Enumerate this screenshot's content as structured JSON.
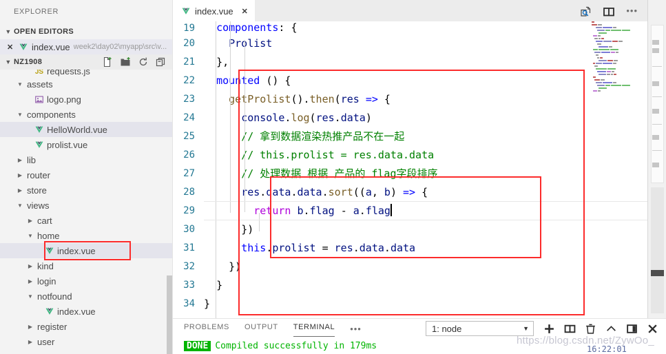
{
  "sidebar": {
    "title": "EXPLORER",
    "open_editors": {
      "header": "OPEN EDITORS",
      "rows": [
        {
          "close": "✕",
          "icon": "vue-icon",
          "name": "index.vue",
          "path": "week2\\day02\\myapp\\src\\v..."
        }
      ]
    },
    "project": {
      "header": "NZ1908",
      "actions": [
        {
          "name": "new-file-icon",
          "title": "New File"
        },
        {
          "name": "new-folder-icon",
          "title": "New Folder"
        },
        {
          "name": "refresh-icon",
          "title": "Refresh Explorer"
        },
        {
          "name": "collapse-all-icon",
          "title": "Collapse Folders"
        }
      ]
    },
    "tree": [
      {
        "label": "requests.js",
        "indent": 2,
        "kind": "js",
        "arrow": "none",
        "selected": false,
        "clipped": true
      },
      {
        "label": "assets",
        "indent": 1,
        "kind": "folder",
        "arrow": "open",
        "selected": false
      },
      {
        "label": "logo.png",
        "indent": 2,
        "kind": "png",
        "arrow": "none",
        "selected": false
      },
      {
        "label": "components",
        "indent": 1,
        "kind": "folder",
        "arrow": "open",
        "selected": false
      },
      {
        "label": "HelloWorld.vue",
        "indent": 2,
        "kind": "vue",
        "arrow": "none",
        "selected": true
      },
      {
        "label": "prolist.vue",
        "indent": 2,
        "kind": "vue",
        "arrow": "none",
        "selected": false
      },
      {
        "label": "lib",
        "indent": 1,
        "kind": "folder",
        "arrow": "closed",
        "selected": false
      },
      {
        "label": "router",
        "indent": 1,
        "kind": "folder",
        "arrow": "closed",
        "selected": false
      },
      {
        "label": "store",
        "indent": 1,
        "kind": "folder",
        "arrow": "closed",
        "selected": false
      },
      {
        "label": "views",
        "indent": 1,
        "kind": "folder",
        "arrow": "open",
        "selected": false
      },
      {
        "label": "cart",
        "indent": 2,
        "kind": "folder",
        "arrow": "closed",
        "selected": false
      },
      {
        "label": "home",
        "indent": 2,
        "kind": "folder",
        "arrow": "open",
        "selected": false
      },
      {
        "label": "index.vue",
        "indent": 3,
        "kind": "vue",
        "arrow": "none",
        "selected": true,
        "highlight": true
      },
      {
        "label": "kind",
        "indent": 2,
        "kind": "folder",
        "arrow": "closed",
        "selected": false
      },
      {
        "label": "login",
        "indent": 2,
        "kind": "folder",
        "arrow": "closed",
        "selected": false
      },
      {
        "label": "notfound",
        "indent": 2,
        "kind": "folder",
        "arrow": "open",
        "selected": false
      },
      {
        "label": "index.vue",
        "indent": 3,
        "kind": "vue",
        "arrow": "none",
        "selected": false
      },
      {
        "label": "register",
        "indent": 2,
        "kind": "folder",
        "arrow": "closed",
        "selected": false
      },
      {
        "label": "user",
        "indent": 2,
        "kind": "folder",
        "arrow": "closed",
        "selected": false
      }
    ]
  },
  "editor": {
    "tab": {
      "name": "index.vue",
      "close": "✕",
      "icon": "vue-icon"
    },
    "tab_actions": [
      {
        "name": "open-preview-icon"
      },
      {
        "name": "split-editor-icon"
      },
      {
        "name": "more-actions-icon",
        "label": "•••"
      }
    ],
    "first_line_number": 19,
    "lines": [
      {
        "n": 19,
        "text": "  components: {",
        "clipped": true
      },
      {
        "n": 20,
        "text": "    Prolist"
      },
      {
        "n": 21,
        "text": "  },"
      },
      {
        "n": 22,
        "text": "  mounted () {"
      },
      {
        "n": 23,
        "text": "    getProlist().then(res => {"
      },
      {
        "n": 24,
        "text": "      console.log(res.data)"
      },
      {
        "n": 25,
        "text": "      // 拿到数据渲染热推产品不在一起"
      },
      {
        "n": 26,
        "text": "      // this.prolist = res.data.data"
      },
      {
        "n": 27,
        "text": "      // 处理数据 根据 产品的 flag字段排序"
      },
      {
        "n": 28,
        "text": "      res.data.data.sort((a, b) => {"
      },
      {
        "n": 29,
        "text": "        return b.flag - a.flag",
        "cursor": true
      },
      {
        "n": 30,
        "text": "      })"
      },
      {
        "n": 31,
        "text": "      this.prolist = res.data.data"
      },
      {
        "n": 32,
        "text": "    })"
      },
      {
        "n": 33,
        "text": "  }"
      },
      {
        "n": 34,
        "text": "}"
      }
    ],
    "annotations": [
      {
        "name": "mounted-block-highlight"
      },
      {
        "name": "sort-block-highlight"
      },
      {
        "name": "sidebar-index-vue-highlight"
      }
    ]
  },
  "panel": {
    "tabs": [
      {
        "label": "PROBLEMS",
        "active": false
      },
      {
        "label": "OUTPUT",
        "active": false
      },
      {
        "label": "TERMINAL",
        "active": true
      }
    ],
    "more": "•••",
    "terminal_select": {
      "value": "1: node",
      "chevron": "▼"
    },
    "actions": [
      {
        "name": "new-terminal-icon",
        "label": "+"
      },
      {
        "name": "split-terminal-icon"
      },
      {
        "name": "kill-terminal-icon"
      },
      {
        "name": "chevron-up-icon"
      },
      {
        "name": "maximize-panel-icon"
      },
      {
        "name": "close-panel-icon"
      }
    ],
    "output": {
      "badge": "DONE",
      "message": "Compiled successfully in 179ms"
    }
  },
  "overlay": {
    "watermark": "https://blog.csdn.net/ZywOo_",
    "clock": "16:22:01"
  },
  "colors": {
    "annotation_red": "#fc2b2b",
    "vue_green": "#41b883",
    "line_number": "#237893",
    "terminal_green": "#00b400",
    "selection": "#e4e4ec"
  }
}
